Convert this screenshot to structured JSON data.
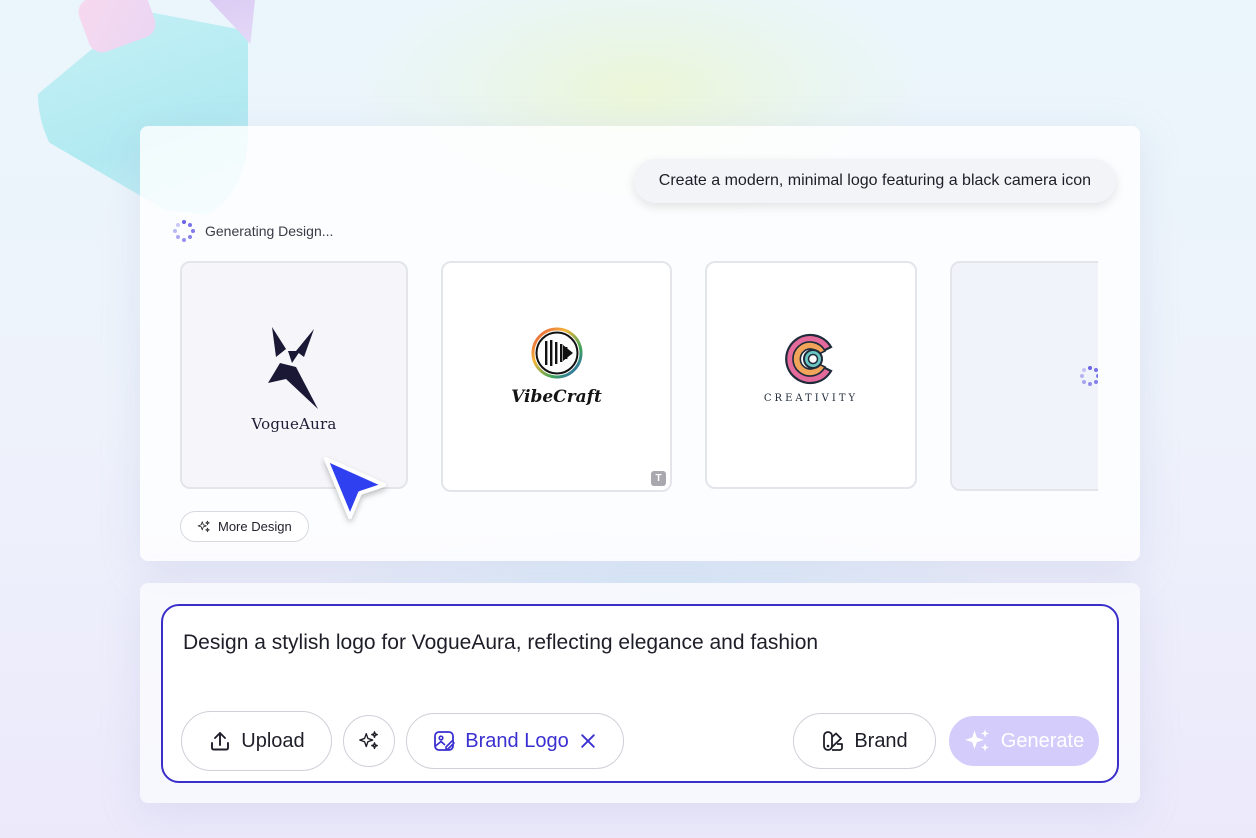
{
  "prompt_bubble": {
    "text": "Create a modern, minimal logo featuring a black camera icon"
  },
  "status": {
    "text": "Generating Design..."
  },
  "designs": [
    {
      "name": "VogueAura"
    },
    {
      "name": "VibeCraft",
      "badge": "T"
    },
    {
      "name": "CREATIVITY"
    }
  ],
  "more_design_label": "More Design",
  "composer": {
    "text": "Design a stylish logo for VogueAura, reflecting elegance and fashion",
    "upload_label": "Upload",
    "brand_logo_label": "Brand Logo",
    "brand_label": "Brand",
    "generate_label": "Generate"
  },
  "colors": {
    "accent": "#3b2fc9",
    "brand_logo_text": "#3a2fd0",
    "generate_disabled": "#d4cdfb",
    "cursor": "#2f3ff0"
  },
  "icons": {
    "spinner": "spinner-icon",
    "sparkle": "sparkle-icon",
    "upload": "upload-icon",
    "brand_logo": "image-edit-icon",
    "close": "close-icon",
    "brand": "brand-kit-icon",
    "cursor": "cursor-icon",
    "text_badge": "text-badge-icon"
  }
}
